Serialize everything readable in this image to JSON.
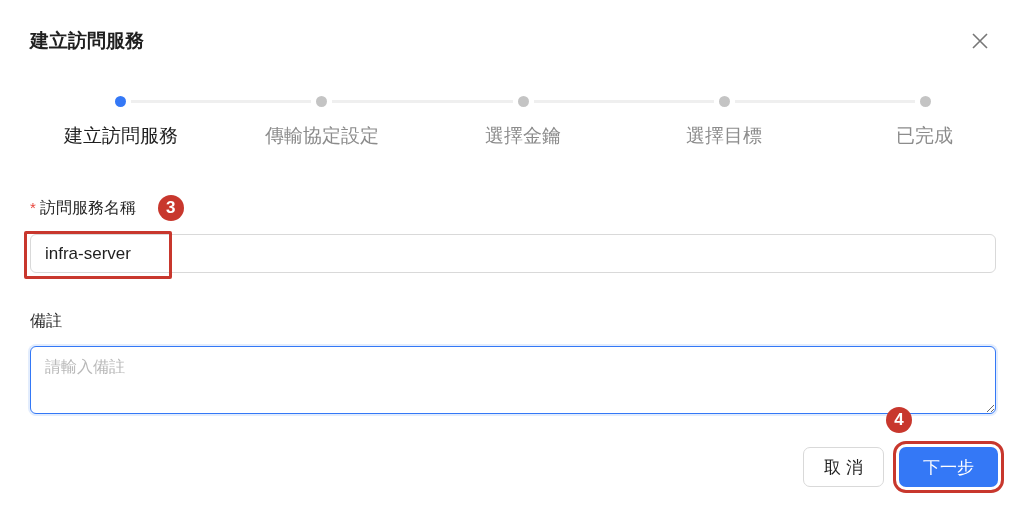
{
  "dialog": {
    "title": "建立訪問服務"
  },
  "steps": [
    {
      "label": "建立訪問服務",
      "selected": true
    },
    {
      "label": "傳輸協定設定",
      "selected": false
    },
    {
      "label": "選擇金鑰",
      "selected": false
    },
    {
      "label": "選擇目標",
      "selected": false
    },
    {
      "label": "已完成",
      "selected": false
    }
  ],
  "name_field": {
    "required_mark": "*",
    "label": "訪問服務名稱",
    "value": "infra-server",
    "badge": "3",
    "highlighted": true
  },
  "remark_field": {
    "label": "備註",
    "placeholder": "請輸入備註",
    "focused": true
  },
  "buttons": [
    {
      "kind": "secondary",
      "label": "取 消",
      "highlighted": false
    },
    {
      "kind": "primary",
      "label": "下一步",
      "highlighted": true,
      "badge": "4"
    }
  ]
}
